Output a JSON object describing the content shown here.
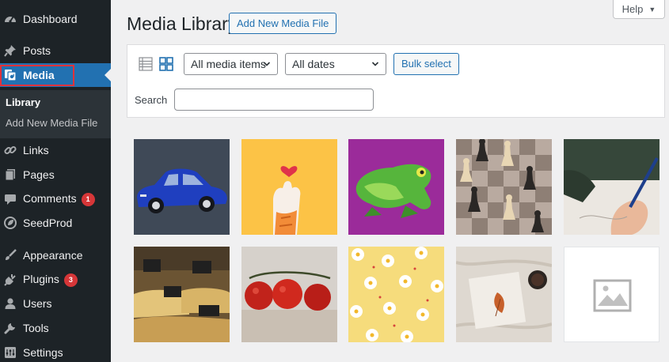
{
  "sidebar": {
    "items": [
      {
        "label": "Dashboard",
        "icon": "dashboard-icon"
      },
      {
        "label": "Posts",
        "icon": "pin-icon"
      },
      {
        "label": "Media",
        "icon": "media-icon"
      },
      {
        "label": "Links",
        "icon": "link-icon"
      },
      {
        "label": "Pages",
        "icon": "pages-icon"
      },
      {
        "label": "Comments",
        "icon": "comment-icon",
        "badge": "1"
      },
      {
        "label": "SeedProd",
        "icon": "seedprod-icon"
      },
      {
        "label": "Appearance",
        "icon": "paintbrush-icon"
      },
      {
        "label": "Plugins",
        "icon": "plug-icon",
        "badge": "3"
      },
      {
        "label": "Users",
        "icon": "user-icon"
      },
      {
        "label": "Tools",
        "icon": "wrench-icon"
      },
      {
        "label": "Settings",
        "icon": "settings-icon"
      }
    ],
    "submenu": [
      {
        "label": "Library"
      },
      {
        "label": "Add New Media File"
      }
    ]
  },
  "header": {
    "title": "Media Library",
    "add_new_label": "Add New Media File",
    "help_label": "Help"
  },
  "toolbar": {
    "filter_type": "All media items",
    "filter_date": "All dates",
    "bulk_label": "Bulk select",
    "search_label": "Search",
    "search_value": ""
  },
  "colors": {
    "sidebar_bg": "#1d2327",
    "accent": "#2271b1",
    "badge": "#d63638",
    "highlight": "#e0323a"
  },
  "media": [
    {
      "subject": "blue-car"
    },
    {
      "subject": "cat-paw-heart"
    },
    {
      "subject": "green-frog"
    },
    {
      "subject": "chess-pattern"
    },
    {
      "subject": "hand-drawing"
    },
    {
      "subject": "cheese-shop"
    },
    {
      "subject": "tomatoes"
    },
    {
      "subject": "flower-pattern"
    },
    {
      "subject": "book-leaf-coffee"
    },
    {
      "subject": "placeholder"
    }
  ]
}
